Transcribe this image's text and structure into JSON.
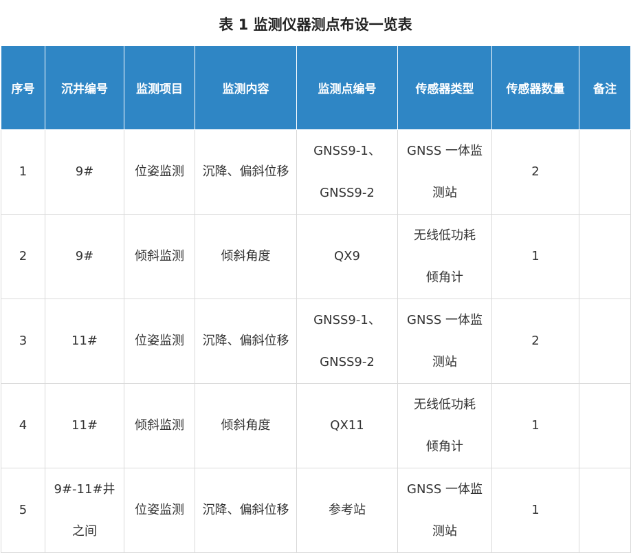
{
  "title": "表 1  监测仪器测点布设一览表",
  "headers": [
    "序号",
    "沉井编号",
    "监测项目",
    "监测内容",
    "监测点编号",
    "传感器类型",
    "传感器数量",
    "备注"
  ],
  "rows": [
    {
      "no": "1",
      "well": [
        "9#"
      ],
      "item": "位姿监测",
      "content": "沉降、偏斜位移",
      "point": [
        "GNSS9-1、",
        "GNSS9-2"
      ],
      "sensor": [
        "GNSS 一体监",
        "测站"
      ],
      "qty": "2",
      "note": ""
    },
    {
      "no": "2",
      "well": [
        "9#"
      ],
      "item": "倾斜监测",
      "content": "倾斜角度",
      "point": [
        "QX9"
      ],
      "sensor": [
        "无线低功耗",
        "倾角计"
      ],
      "qty": "1",
      "note": ""
    },
    {
      "no": "3",
      "well": [
        "11#"
      ],
      "item": "位姿监测",
      "content": "沉降、偏斜位移",
      "point": [
        "GNSS9-1、",
        "GNSS9-2"
      ],
      "sensor": [
        "GNSS 一体监",
        "测站"
      ],
      "qty": "2",
      "note": ""
    },
    {
      "no": "4",
      "well": [
        "11#"
      ],
      "item": "倾斜监测",
      "content": "倾斜角度",
      "point": [
        "QX11"
      ],
      "sensor": [
        "无线低功耗",
        "倾角计"
      ],
      "qty": "1",
      "note": ""
    },
    {
      "no": "5",
      "well": [
        "9#-11#井",
        "之间"
      ],
      "item": "位姿监测",
      "content": "沉降、偏斜位移",
      "point": [
        "参考站"
      ],
      "sensor": [
        "GNSS 一体监",
        "测站"
      ],
      "qty": "1",
      "note": ""
    }
  ]
}
